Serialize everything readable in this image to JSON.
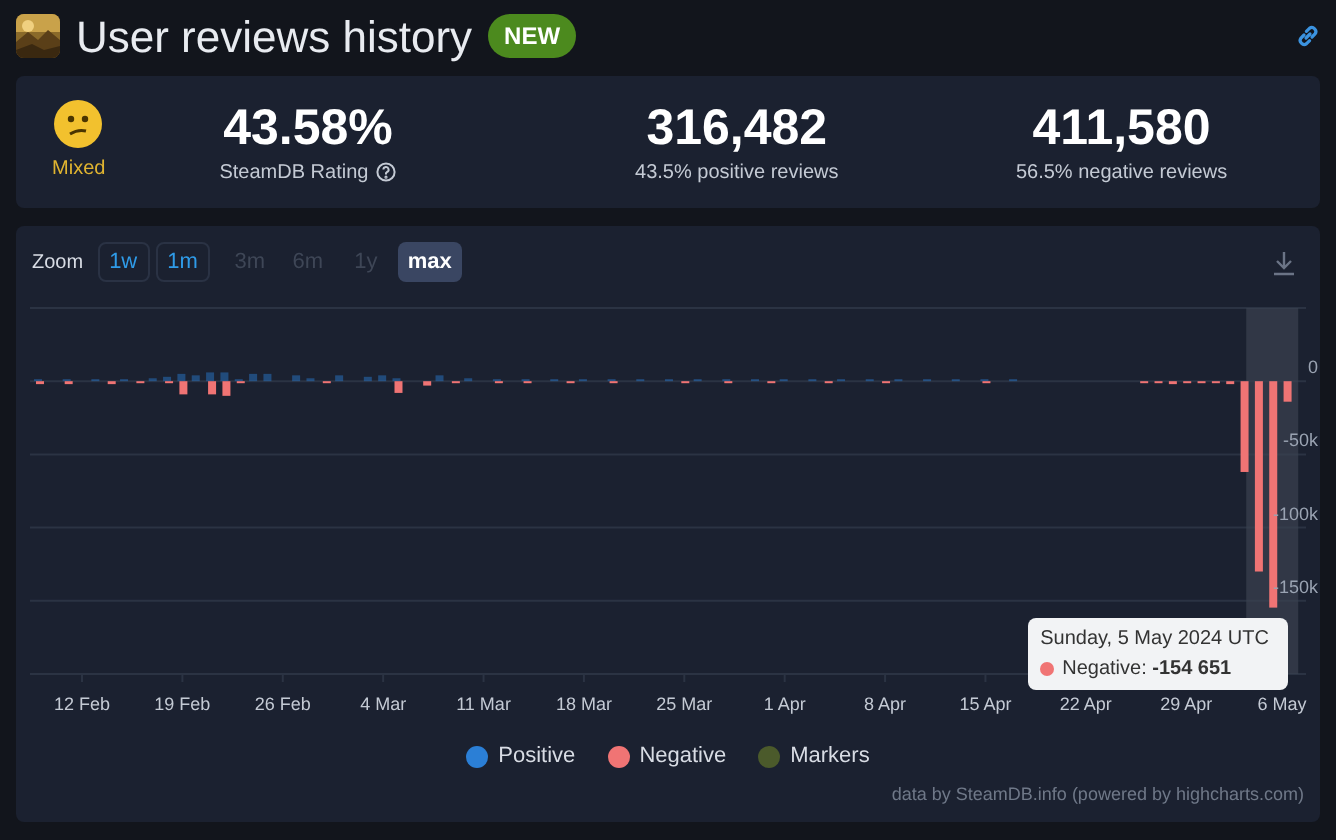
{
  "header": {
    "title": "User reviews history",
    "badge": "NEW"
  },
  "summary": {
    "rating_label": "Mixed",
    "stats": [
      {
        "value": "43.58%",
        "caption": "SteamDB Rating",
        "help": true
      },
      {
        "value": "316,482",
        "caption": "43.5% positive reviews"
      },
      {
        "value": "411,580",
        "caption": "56.5% negative reviews"
      }
    ]
  },
  "chart_panel": {
    "zoom_label": "Zoom",
    "zoom_buttons": [
      {
        "label": "1w",
        "selected": false,
        "disabled": false
      },
      {
        "label": "1m",
        "selected": false,
        "disabled": false
      },
      {
        "label": "3m",
        "selected": false,
        "disabled": true
      },
      {
        "label": "6m",
        "selected": false,
        "disabled": true
      },
      {
        "label": "1y",
        "selected": false,
        "disabled": true
      },
      {
        "label": "max",
        "selected": true,
        "disabled": false
      }
    ],
    "chart_data": {
      "type": "bar",
      "stacked": false,
      "grid": true,
      "categories": [
        null,
        null,
        null,
        "12 Feb",
        null,
        null,
        null,
        null,
        null,
        null,
        "19 Feb",
        null,
        null,
        null,
        null,
        null,
        null,
        "26 Feb",
        null,
        null,
        null,
        null,
        null,
        null,
        "4 Mar",
        null,
        null,
        null,
        null,
        null,
        null,
        "11 Mar",
        null,
        null,
        null,
        null,
        null,
        null,
        "18 Mar",
        null,
        null,
        null,
        null,
        null,
        null,
        "25 Mar",
        null,
        null,
        null,
        null,
        null,
        null,
        "1 Apr",
        null,
        null,
        null,
        null,
        null,
        null,
        "8 Apr",
        null,
        null,
        null,
        null,
        null,
        null,
        "15 Apr",
        null,
        null,
        null,
        null,
        null,
        null,
        "22 Apr",
        null,
        null,
        null,
        null,
        null,
        null,
        "29 Apr",
        null,
        null,
        null,
        null,
        null,
        null,
        "6 May"
      ],
      "series": [
        {
          "name": "Positive",
          "color": "#2b7fd6",
          "values": [
            1000,
            0,
            1000,
            0,
            1000,
            0,
            1000,
            0,
            2000,
            3000,
            5000,
            4000,
            6000,
            6000,
            1000,
            5000,
            5000,
            0,
            4000,
            2000,
            0,
            4000,
            0,
            3000,
            4000,
            2000,
            0,
            0,
            4000,
            0,
            2000,
            0,
            1000,
            0,
            1000,
            0,
            1000,
            0,
            1000,
            0,
            1000,
            0,
            1000,
            0,
            1000,
            0,
            1000,
            0,
            1000,
            0,
            1000,
            0,
            1000,
            0,
            1000,
            0,
            1000,
            0,
            1000,
            0,
            1000,
            0,
            1000,
            0,
            1000,
            0,
            1000,
            0,
            1000,
            0,
            0,
            0,
            0,
            0,
            0,
            0,
            0,
            0,
            0,
            0,
            0,
            0,
            0,
            0,
            0,
            0,
            0,
            0
          ]
        },
        {
          "name": "Negative",
          "color": "#f07474",
          "values": [
            -2000,
            0,
            -2000,
            0,
            0,
            -2000,
            0,
            -1000,
            0,
            -1000,
            -9000,
            0,
            -9000,
            -10000,
            -1000,
            0,
            0,
            0,
            0,
            0,
            -1000,
            0,
            0,
            0,
            0,
            -8000,
            0,
            -3000,
            0,
            -1000,
            0,
            0,
            -1000,
            0,
            -1000,
            0,
            0,
            -1000,
            0,
            0,
            -1000,
            0,
            0,
            0,
            0,
            -1000,
            0,
            0,
            -1000,
            0,
            0,
            -1000,
            0,
            0,
            0,
            -1000,
            0,
            0,
            0,
            -1000,
            0,
            0,
            0,
            0,
            0,
            0,
            -1000,
            0,
            0,
            0,
            0,
            0,
            0,
            0,
            0,
            0,
            0,
            -1000,
            -1000,
            -2000,
            -1000,
            -1000,
            -1000,
            -2000,
            -62000,
            -130000,
            -154651,
            -14000
          ]
        }
      ],
      "ylim": [
        -200000,
        50000
      ],
      "yticks": [
        {
          "value": 0,
          "label": "0"
        },
        {
          "value": -50000,
          "label": "-50k"
        },
        {
          "value": -100000,
          "label": "-100k"
        },
        {
          "value": -150000,
          "label": "-150k"
        }
      ]
    },
    "tooltip": {
      "title": "Sunday, 5 May 2024 UTC",
      "text": "Negative: **-154 651**"
    },
    "legend_extra": [
      {
        "label": "Markers",
        "color": "#4b5a2b"
      }
    ],
    "credit": "data by SteamDB.info (powered by highcharts.com)"
  }
}
